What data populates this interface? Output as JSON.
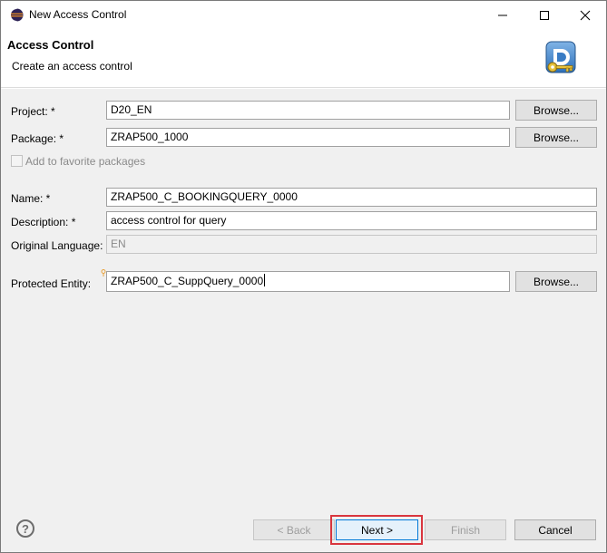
{
  "window": {
    "title": "New Access Control",
    "icons": {
      "app": "eclipse-icon",
      "minimize": "minimize-icon",
      "maximize": "maximize-icon",
      "close": "close-icon"
    }
  },
  "header": {
    "title": "Access Control",
    "subtitle": "Create an access control",
    "icon": "access-control-key-icon"
  },
  "form": {
    "project": {
      "label": "Project: *",
      "value": "D20_EN",
      "browse": "Browse..."
    },
    "package": {
      "label": "Package: *",
      "value": "ZRAP500_1000",
      "browse": "Browse..."
    },
    "favorite": {
      "label": "Add to favorite packages",
      "checked": false
    },
    "name": {
      "label": "Name: *",
      "value": "ZRAP500_C_BOOKINGQUERY_0000"
    },
    "description": {
      "label": "Description: *",
      "value": "access control for query"
    },
    "language": {
      "label": "Original Language:",
      "value": "EN"
    },
    "entity": {
      "label": "Protected Entity:",
      "value": "ZRAP500_C_SuppQuery_0000",
      "browse": "Browse..."
    }
  },
  "footer": {
    "help_icon": "help-icon",
    "back": "< Back",
    "next": "Next >",
    "finish": "Finish",
    "cancel": "Cancel"
  },
  "colors": {
    "highlight": "#d9363e",
    "panel": "#f0f0f0",
    "primary_border": "#0078d7"
  }
}
